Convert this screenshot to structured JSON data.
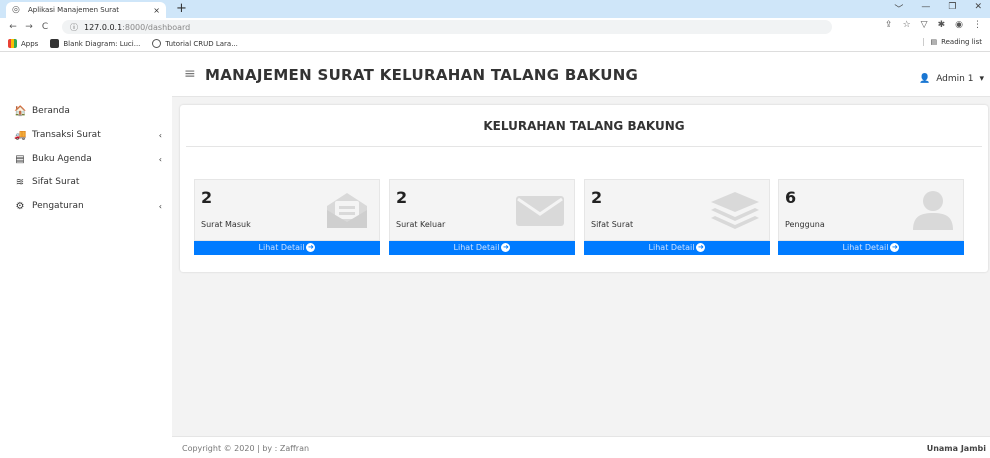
{
  "browser": {
    "tab_title": "Aplikasi Manajemen Surat",
    "tab_close": "×",
    "new_tab": "+",
    "win_controls": [
      "﹀",
      "—",
      "❐",
      "✕"
    ],
    "url_host": "127.0.0.1",
    "url_rest": ":8000/dashboard",
    "nav": [
      "←",
      "→",
      "C"
    ],
    "addr_icons": [
      "⇪",
      "☆",
      "▽",
      "✱",
      "◉",
      "⋮"
    ],
    "bookmarks": [
      "Apps",
      "Blank Diagram: Luci...",
      "Tutorial CRUD Lara..."
    ],
    "reading_list": "Reading list"
  },
  "app": {
    "title": "MANAJEMEN SURAT KELURAHAN TALANG BAKUNG",
    "user": "Admin 1"
  },
  "sidebar": {
    "items": [
      {
        "label": "Beranda",
        "icon": "home-icon",
        "glyph": "🏠",
        "chev": ""
      },
      {
        "label": "Transaksi Surat",
        "icon": "truck-icon",
        "glyph": "🚚",
        "chev": "‹"
      },
      {
        "label": "Buku Agenda",
        "icon": "book-icon",
        "glyph": "▤",
        "chev": "‹"
      },
      {
        "label": "Sifat Surat",
        "icon": "layers-icon",
        "glyph": "≋",
        "chev": ""
      },
      {
        "label": "Pengaturan",
        "icon": "cogs-icon",
        "glyph": "⚙",
        "chev": "‹"
      }
    ]
  },
  "dashboard": {
    "heading": "KELURAHAN TALANG BAKUNG",
    "cards": [
      {
        "value": "2",
        "label": "Surat Masuk",
        "icon": "envelope-open-icon",
        "link": "Lihat Detail"
      },
      {
        "value": "2",
        "label": "Surat Keluar",
        "icon": "envelope-icon",
        "link": "Lihat Detail"
      },
      {
        "value": "2",
        "label": "Sifat Surat",
        "icon": "layers-icon",
        "link": "Lihat Detail"
      },
      {
        "value": "6",
        "label": "Pengguna",
        "icon": "user-icon",
        "link": "Lihat Detail"
      }
    ]
  },
  "footer": {
    "left": "Copyright © 2020 | by : Zaffran",
    "right": "Unama Jambi"
  },
  "colors": {
    "accent": "#007bff",
    "sidebar_bg": "#ffffff",
    "content_bg": "#f3f3f3"
  }
}
